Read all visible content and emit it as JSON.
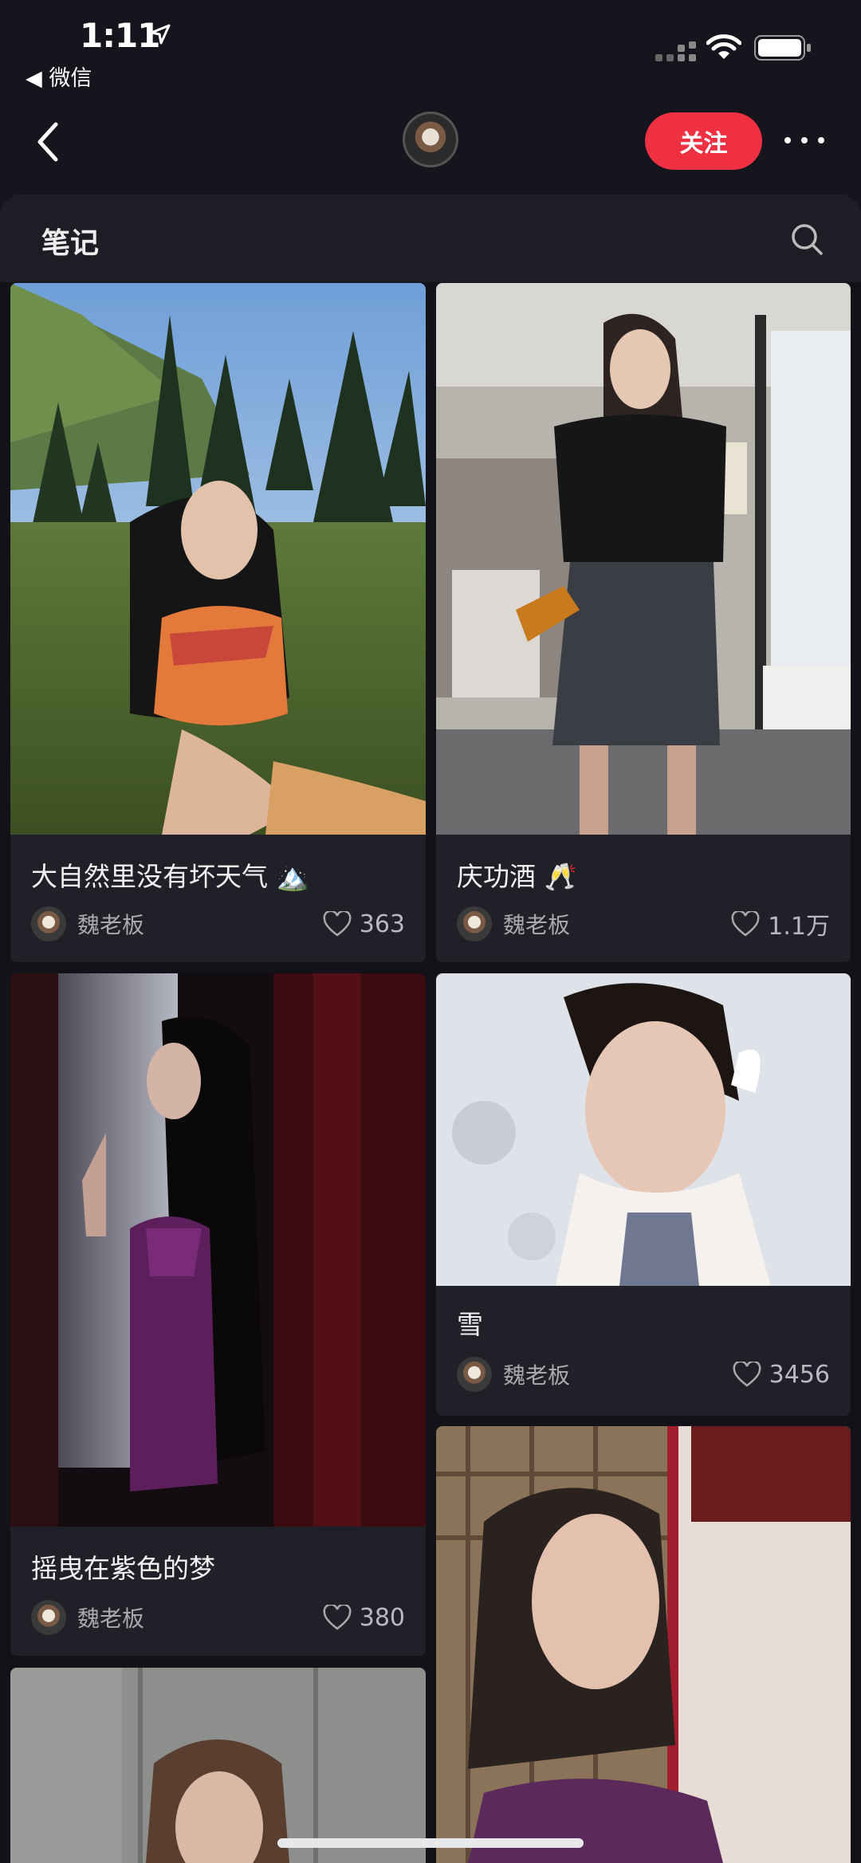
{
  "status_bar": {
    "time": "1:11",
    "back_app": "◀ 微信"
  },
  "nav": {
    "follow_label": "关注"
  },
  "section": {
    "title": "笔记"
  },
  "notes": [
    {
      "title": "大自然里没有坏天气 🏔️",
      "author": "魏老板",
      "likes": "363"
    },
    {
      "title": "庆功酒 🥂",
      "author": "魏老板",
      "likes": "1.1万"
    },
    {
      "title": "摇曳在紫色的梦",
      "author": "魏老板",
      "likes": "380"
    },
    {
      "title": "雪",
      "author": "魏老板",
      "likes": "3456"
    }
  ],
  "colors": {
    "accent": "#ee3042",
    "background": "#15151d",
    "card": "#202028"
  },
  "icons": [
    "location-arrow-icon",
    "signal-icon",
    "wifi-icon",
    "battery-icon",
    "back-chevron-icon",
    "more-icon",
    "search-icon",
    "heart-icon"
  ]
}
